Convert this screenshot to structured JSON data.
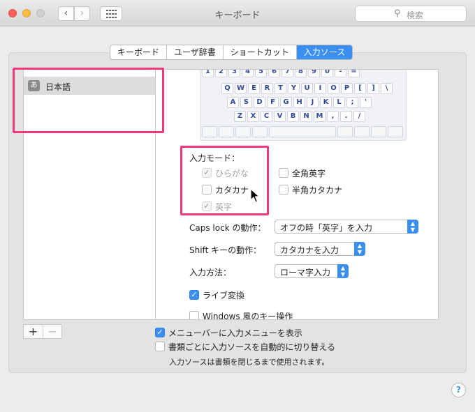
{
  "window": {
    "title": "キーボード"
  },
  "toolbar": {
    "back_glyph": "‹",
    "forward_glyph": "›",
    "search_placeholder": "検索",
    "search_icon": "⚲"
  },
  "tabs": [
    {
      "label": "キーボード",
      "active": false
    },
    {
      "label": "ユーザ辞書",
      "active": false
    },
    {
      "label": "ショートカット",
      "active": false
    },
    {
      "label": "入力ソース",
      "active": true
    }
  ],
  "sources": [
    {
      "icon_text": "あ",
      "label": "日本語",
      "selected": true
    }
  ],
  "keyboard_rows": [
    [
      "1",
      "2",
      "3",
      "4",
      "5",
      "6",
      "7",
      "8",
      "9",
      "0",
      "-",
      "="
    ],
    [
      "Q",
      "W",
      "E",
      "R",
      "T",
      "Y",
      "U",
      "I",
      "O",
      "P",
      "[",
      "]",
      "\\"
    ],
    [
      "A",
      "S",
      "D",
      "F",
      "G",
      "H",
      "J",
      "K",
      "L",
      ";",
      "'"
    ],
    [
      "Z",
      "X",
      "C",
      "V",
      "B",
      "N",
      "M",
      ",",
      ".",
      "/"
    ]
  ],
  "input_modes": {
    "heading": "入力モード：",
    "items": [
      {
        "label": "ひらがな",
        "checked": true,
        "disabled": true
      },
      {
        "label": "カタカナ",
        "checked": false,
        "disabled": false
      },
      {
        "label": "英字",
        "checked": true,
        "disabled": true
      },
      {
        "label": "全角英字",
        "checked": false,
        "disabled": false
      },
      {
        "label": "半角カタカナ",
        "checked": false,
        "disabled": false
      }
    ]
  },
  "settings": {
    "caps_lock": {
      "label": "Caps lock の動作：",
      "value": "オフの時「英字」を入力"
    },
    "shift": {
      "label": "Shift キーの動作：",
      "value": "カタカナを入力"
    },
    "method": {
      "label": "入力方法：",
      "value": "ローマ字入力"
    },
    "live": {
      "label": "ライブ変換",
      "checked": true
    },
    "windows": {
      "label": "Windows 風のキー操作",
      "checked": false
    }
  },
  "list_buttons": {
    "add": "+",
    "remove": "−"
  },
  "bottom": {
    "show_menu": {
      "label": "メニューバーに入力メニューを表示",
      "checked": true
    },
    "auto_switch": {
      "label": "書類ごとに入力ソースを自動的に切り替える",
      "checked": false
    },
    "note": "入力ソースは書類を閉じるまで使用されます。"
  },
  "help": "?",
  "colors": {
    "accent": "#3b8ff2",
    "highlight": "#ee3a7c"
  }
}
